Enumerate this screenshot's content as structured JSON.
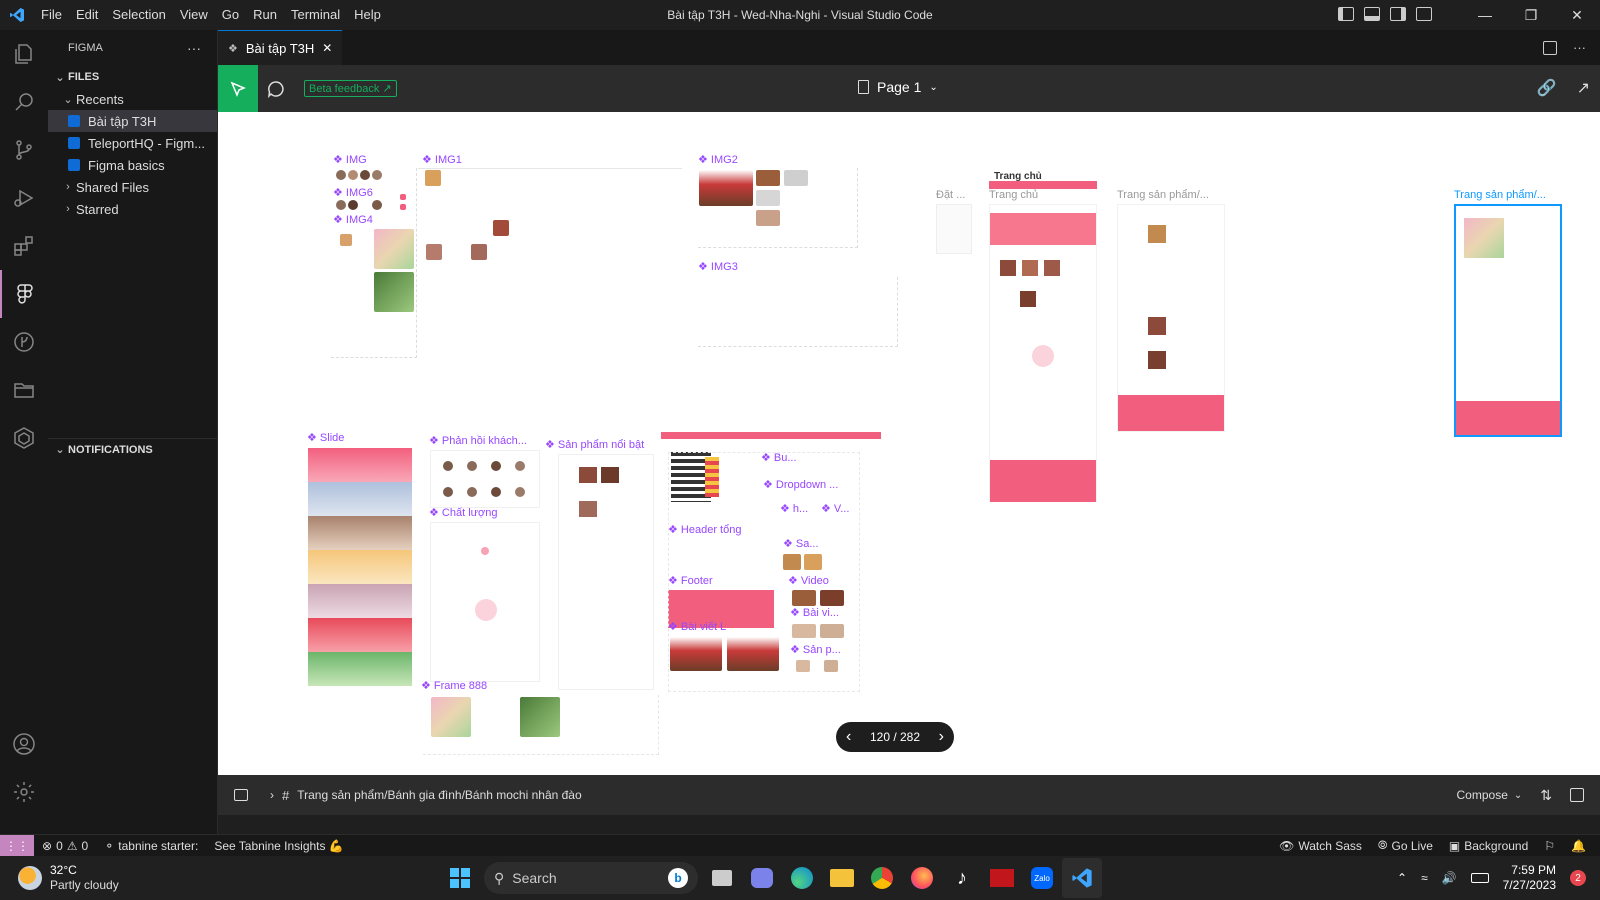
{
  "titlebar": {
    "menu": [
      "File",
      "Edit",
      "Selection",
      "View",
      "Go",
      "Run",
      "Terminal",
      "Help"
    ],
    "title": "Bài tập T3H - Wed-Nha-Nghi - Visual Studio Code",
    "controls": [
      "minimize",
      "maximize",
      "close"
    ]
  },
  "activity": [
    "explorer-icon",
    "search-icon",
    "source-control-icon",
    "run-debug-icon",
    "extensions-icon",
    "figma-icon",
    "git-graph-icon",
    "folder-icon",
    "tabnine-icon"
  ],
  "sidebar": {
    "title": "FIGMA",
    "more": "···",
    "files_label": "FILES",
    "recents_label": "Recents",
    "recents": [
      "Bài tập T3H",
      "TeleportHQ - Figm...",
      "Figma basics"
    ],
    "shared_label": "Shared Files",
    "starred_label": "Starred",
    "notifications_label": "NOTIFICATIONS"
  },
  "tab": {
    "label": "Bài tập T3H",
    "close": "✕"
  },
  "figma": {
    "beta_label": "Beta feedback",
    "page_label": "Page 1",
    "pager": "120 / 282"
  },
  "canvas_labels": {
    "img": "IMG",
    "img6": "IMG6",
    "img4": "IMG4",
    "img1": "IMG1",
    "img2": "IMG2",
    "img3": "IMG3",
    "trang_chu_top": "Trang chủ",
    "dat": "Đặt ...",
    "trang_chu": "Trang chủ",
    "trang_sp1": "Trang sản phẩm/...",
    "trang_sp2": "Trang sản phẩm/...",
    "slide": "Slide",
    "phan_hoi": "Phản hồi khách...",
    "chat_luong": "Chất lượng",
    "san_pham_noi_bat": "Sản phẩm nổi bật",
    "bu": "Bu...",
    "dropdown": "Dropdown ...",
    "h": "h...",
    "v": "V...",
    "header_tong": "Header tổng",
    "sa": "Sa...",
    "footer": "Footer",
    "video": "Video",
    "bai_vi": "Bài vi...",
    "bai_viet_l": "Bài viết L",
    "san_p": "Sản p...",
    "frame888": "Frame 888"
  },
  "breadcrumb": {
    "path": "Trang sản phẩm/Bánh gia đình/Bánh mochi nhân đào",
    "compose_label": "Compose"
  },
  "statusbar": {
    "errors": "0",
    "warnings": "0",
    "tabnine": "tabnine starter:",
    "insights": "See Tabnine Insights 💪",
    "watch_sass": "Watch Sass",
    "go_live": "Go Live",
    "background": "Background"
  },
  "taskbar": {
    "temp": "32°C",
    "weather": "Partly cloudy",
    "search_placeholder": "Search",
    "time": "7:59 PM",
    "date": "7/27/2023",
    "notif_count": "2"
  },
  "colors": {
    "accent": "#14ae5c",
    "figma_label": "#9747ff",
    "pink": "#f25f7e"
  }
}
